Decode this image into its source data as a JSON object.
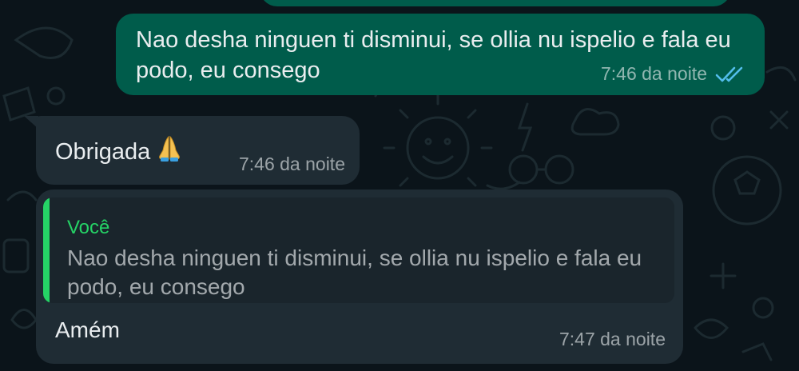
{
  "messages": [
    {
      "direction": "outgoing",
      "text": "Nao desha ninguen ti disminui, se ollia nu ispelio e fala eu podo, eu consego",
      "time": "7:46 da noite",
      "status_icon": "double-check-read-icon"
    },
    {
      "direction": "incoming",
      "text": "Obrigada",
      "emoji": "🙏",
      "time": "7:46 da noite"
    },
    {
      "direction": "incoming",
      "quoted": {
        "author": "Você",
        "text": "Nao desha ninguen ti disminui, se ollia nu ispelio e fala eu podo, eu consego"
      },
      "text": "Amém",
      "time": "7:47 da noite"
    }
  ],
  "colors": {
    "background": "#0b141a",
    "outgoing_bubble": "#005c4b",
    "incoming_bubble": "#1f2c34",
    "quote_accent": "#25d366",
    "read_ticks": "#53bdeb"
  }
}
